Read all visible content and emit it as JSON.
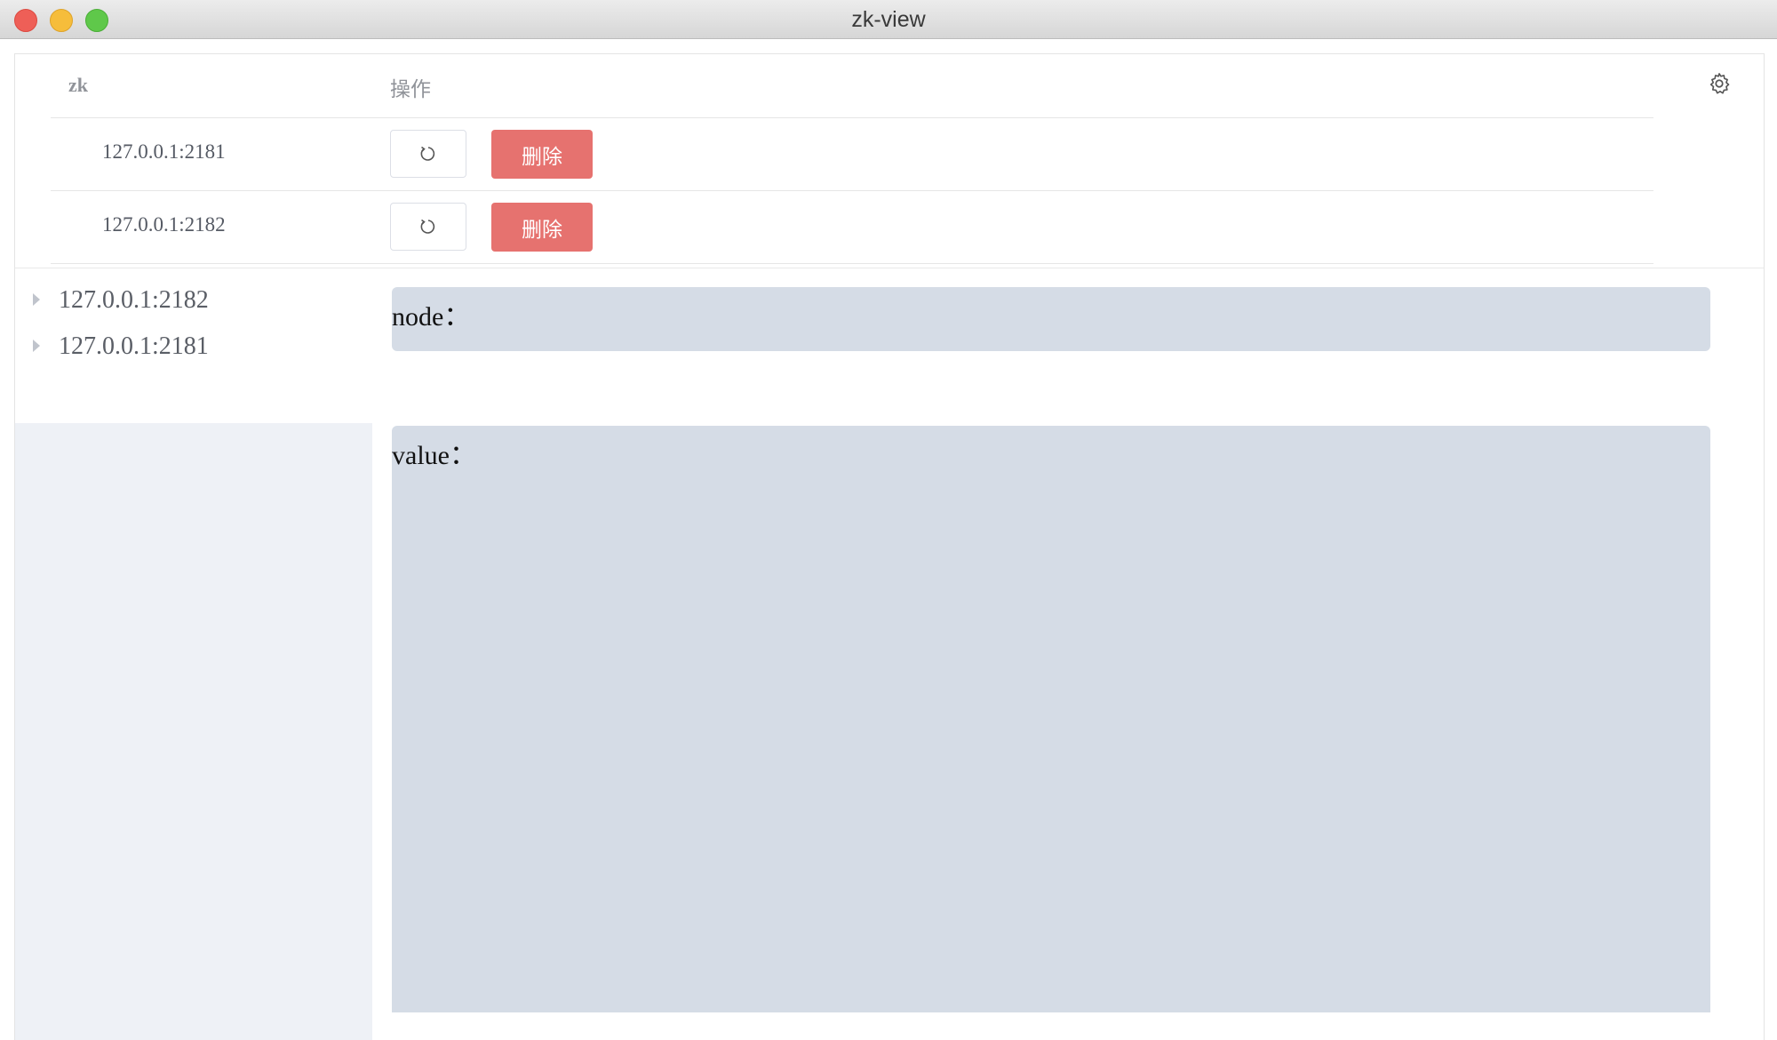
{
  "window": {
    "title": "zk-view"
  },
  "table": {
    "headers": {
      "zk": "zk",
      "operation": "操作"
    },
    "rows": [
      {
        "address": "127.0.0.1:2181",
        "delete_label": "删除"
      },
      {
        "address": "127.0.0.1:2182",
        "delete_label": "删除"
      }
    ]
  },
  "tree": {
    "items": [
      {
        "label": "127.0.0.1:2182"
      },
      {
        "label": "127.0.0.1:2181"
      }
    ]
  },
  "detail": {
    "node_label": "node：",
    "value_label": "value："
  },
  "icons": {
    "refresh": "refresh-icon",
    "settings": "gear-icon",
    "tree_toggle": "caret-right-icon"
  },
  "colors": {
    "delete_button": "#e6726f",
    "panel_fill": "#d5dce6",
    "sidebar_fill": "#eef1f6"
  }
}
